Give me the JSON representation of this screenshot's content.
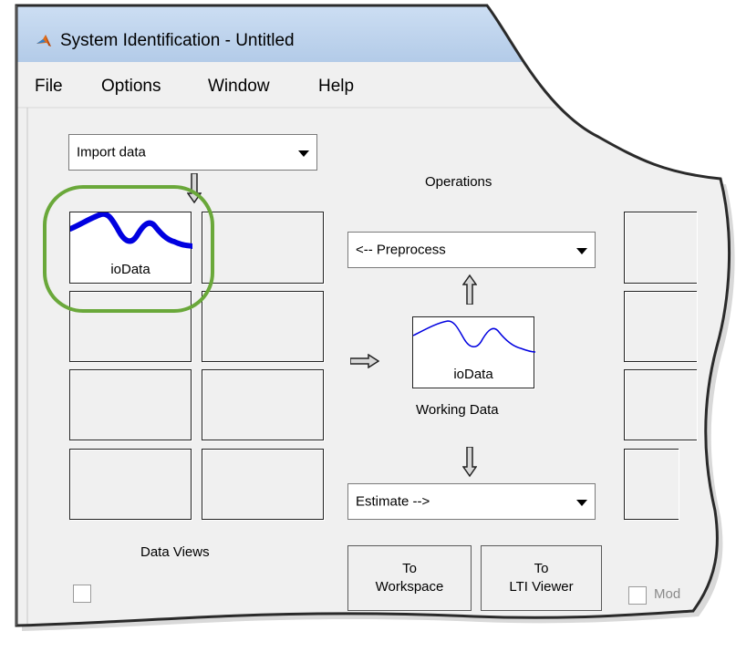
{
  "window": {
    "title": "System Identification - Untitled",
    "app_icon": "matlab-logo-icon"
  },
  "menu": [
    "File",
    "Options",
    "Window",
    "Help"
  ],
  "import_popup": {
    "value": "Import data"
  },
  "data_views": {
    "label": "Data Views",
    "items": [
      {
        "name": "ioData"
      }
    ]
  },
  "operations": {
    "label": "Operations",
    "preprocess_popup": {
      "value": "<-- Preprocess"
    },
    "working_data": {
      "name": "ioData",
      "label": "Working Data"
    },
    "estimate_popup": {
      "value": "Estimate -->"
    }
  },
  "buttons": {
    "to_workspace": [
      "To",
      "Workspace"
    ],
    "to_lti_viewer": [
      "To",
      "LTI Viewer"
    ]
  },
  "model_checkbox": {
    "label": "Mod"
  },
  "colors": {
    "plot_line": "#0000e0",
    "highlight": "#6aa83a",
    "window_bg": "#f0f0f0",
    "titlebar": "#bcd3ee"
  }
}
